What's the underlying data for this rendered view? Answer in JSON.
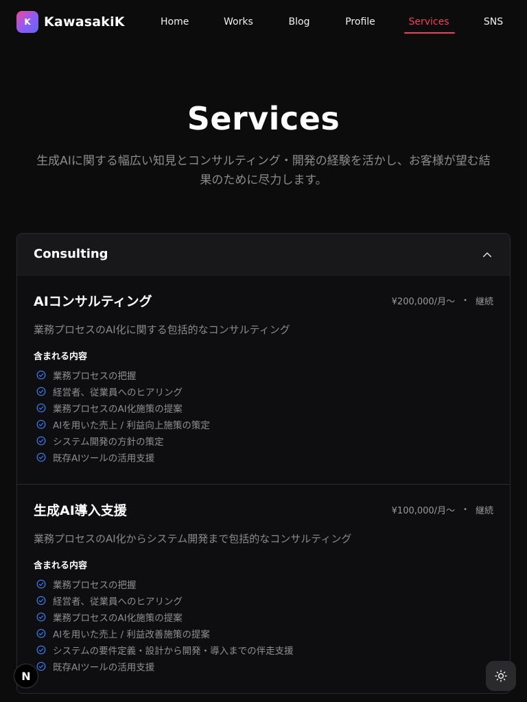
{
  "header": {
    "logo_letter": "K",
    "logo_text": "KawasakiK",
    "nav": [
      {
        "label": "Home"
      },
      {
        "label": "Works"
      },
      {
        "label": "Blog"
      },
      {
        "label": "Profile"
      },
      {
        "label": "Services",
        "active": true
      },
      {
        "label": "SNS"
      }
    ]
  },
  "hero": {
    "title": "Services",
    "subtitle": "生成AIに関する幅広い知見とコンサルティング・開発の経験を活かし、お客様が望む結果のために尽力します。"
  },
  "section": {
    "title": "Consulting",
    "expanded": true,
    "services": [
      {
        "title": "AIコンサルティング",
        "price": "¥200,000/月～",
        "term": "継続",
        "description": "業務プロセスのAI化に関する包括的なコンサルティング",
        "includes_label": "含まれる内容",
        "items": [
          "業務プロセスの把握",
          "経営者、従業員へのヒアリング",
          "業務プロセスのAI化施策の提案",
          "AIを用いた売上 / 利益向上施策の策定",
          "システム開発の方針の策定",
          "既存AIツールの活用支援"
        ]
      },
      {
        "title": "生成AI導入支援",
        "price": "¥100,000/月～",
        "term": "継続",
        "description": "業務プロセスのAI化からシステム開発まで包括的なコンサルティング",
        "includes_label": "含まれる内容",
        "items": [
          "業務プロセスの把握",
          "経営者、従業員へのヒアリング",
          "業務プロセスのAI化施策の提案",
          "AIを用いた売上 / 利益改善施策の提案",
          "システムの要件定義・設計から開発・導入までの伴走支援",
          "既存AIツールの活用支援"
        ]
      }
    ]
  },
  "floating": {
    "next_badge": "N",
    "theme_icon": "sun-icon"
  },
  "colors": {
    "background": "#0c0c0d",
    "accent": "#f43f5e",
    "check": "#3b82f6"
  }
}
